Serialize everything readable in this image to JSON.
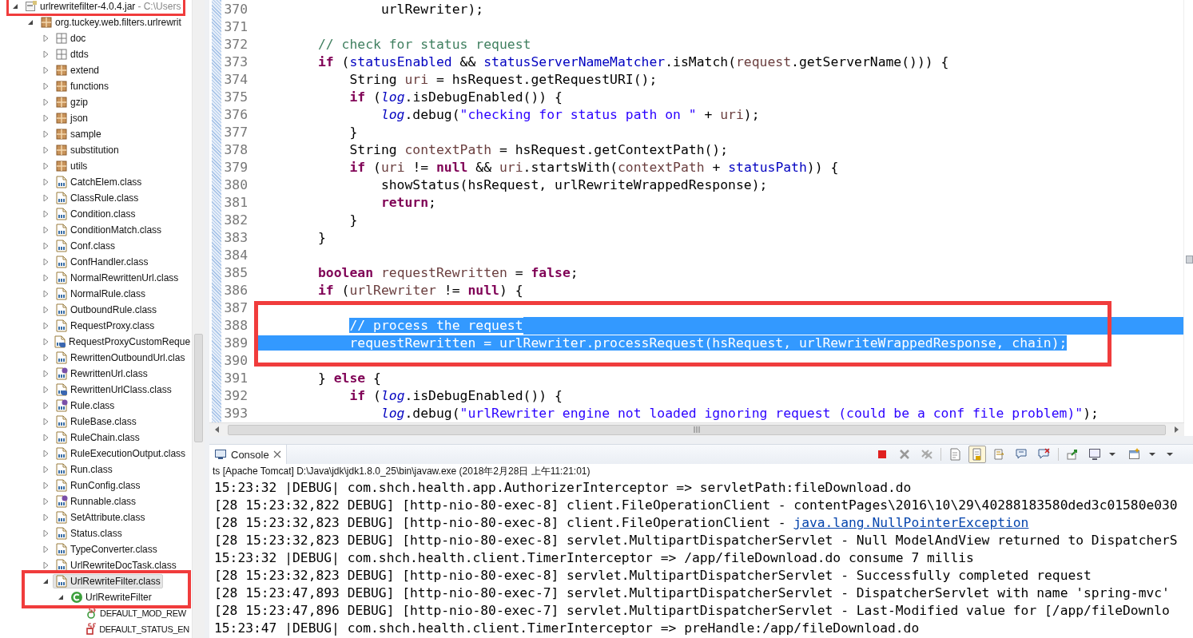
{
  "package_explorer": {
    "tree": [
      {
        "label": "urlrewritefilter-4.0.4.jar",
        "decoration": "- C:\\Users",
        "kind": "jar",
        "expanded": true,
        "selected": false,
        "children": [
          {
            "label": "org.tuckey.web.filters.urlrewrit",
            "kind": "package",
            "expanded": true,
            "selected": false,
            "children": [
              {
                "label": "doc",
                "kind": "folder",
                "expanded": false,
                "selected": false
              },
              {
                "label": "dtds",
                "kind": "folder",
                "expanded": false,
                "selected": false
              },
              {
                "label": "extend",
                "kind": "package",
                "expanded": false,
                "selected": false
              },
              {
                "label": "functions",
                "kind": "package",
                "expanded": false,
                "selected": false
              },
              {
                "label": "gzip",
                "kind": "package",
                "expanded": false,
                "selected": false
              },
              {
                "label": "json",
                "kind": "package",
                "expanded": false,
                "selected": false
              },
              {
                "label": "sample",
                "kind": "package",
                "expanded": false,
                "selected": false
              },
              {
                "label": "substitution",
                "kind": "package",
                "expanded": false,
                "selected": false
              },
              {
                "label": "utils",
                "kind": "package",
                "expanded": false,
                "selected": false
              },
              {
                "label": "CatchElem.class",
                "kind": "classfile",
                "expanded": false,
                "selected": false
              },
              {
                "label": "ClassRule.class",
                "kind": "classfile",
                "expanded": false,
                "selected": false
              },
              {
                "label": "Condition.class",
                "kind": "classfile",
                "expanded": false,
                "selected": false
              },
              {
                "label": "ConditionMatch.class",
                "kind": "classfile",
                "expanded": false,
                "selected": false
              },
              {
                "label": "Conf.class",
                "kind": "classfile",
                "expanded": false,
                "selected": false
              },
              {
                "label": "ConfHandler.class",
                "kind": "classfile",
                "expanded": false,
                "selected": false
              },
              {
                "label": "NormalRewrittenUrl.class",
                "kind": "classfile",
                "expanded": false,
                "selected": false
              },
              {
                "label": "NormalRule.class",
                "kind": "classfile",
                "expanded": false,
                "selected": false
              },
              {
                "label": "OutboundRule.class",
                "kind": "classfile",
                "expanded": false,
                "selected": false
              },
              {
                "label": "RequestProxy.class",
                "kind": "classfile",
                "expanded": false,
                "selected": false
              },
              {
                "label": "RequestProxyCustomReque",
                "kind": "classfile-inner",
                "expanded": false,
                "selected": false
              },
              {
                "label": "RewrittenOutboundUrl.clas",
                "kind": "classfile",
                "expanded": false,
                "selected": false
              },
              {
                "label": "RewrittenUrl.class",
                "kind": "classfile-interface",
                "expanded": false,
                "selected": false
              },
              {
                "label": "RewrittenUrlClass.class",
                "kind": "classfile-inner",
                "expanded": false,
                "selected": false
              },
              {
                "label": "Rule.class",
                "kind": "classfile-interface",
                "expanded": false,
                "selected": false
              },
              {
                "label": "RuleBase.class",
                "kind": "classfile",
                "expanded": false,
                "selected": false
              },
              {
                "label": "RuleChain.class",
                "kind": "classfile",
                "expanded": false,
                "selected": false
              },
              {
                "label": "RuleExecutionOutput.class",
                "kind": "classfile",
                "expanded": false,
                "selected": false
              },
              {
                "label": "Run.class",
                "kind": "classfile",
                "expanded": false,
                "selected": false
              },
              {
                "label": "RunConfig.class",
                "kind": "classfile",
                "expanded": false,
                "selected": false
              },
              {
                "label": "Runnable.class",
                "kind": "classfile-interface",
                "expanded": false,
                "selected": false
              },
              {
                "label": "SetAttribute.class",
                "kind": "classfile",
                "expanded": false,
                "selected": false
              },
              {
                "label": "Status.class",
                "kind": "classfile",
                "expanded": false,
                "selected": false
              },
              {
                "label": "TypeConverter.class",
                "kind": "classfile",
                "expanded": false,
                "selected": false
              },
              {
                "label": "UrlRewriteDocTask.class",
                "kind": "classfile",
                "expanded": false,
                "selected": false
              },
              {
                "label": "UrlRewriteFilter.class",
                "kind": "classfile",
                "expanded": true,
                "selected": true,
                "children": [
                  {
                    "label": "UrlRewriteFilter",
                    "kind": "class",
                    "expanded": true,
                    "selected": false,
                    "children": [
                      {
                        "label": "DEFAULT_MOD_REW",
                        "kind": "field-public",
                        "selected": false
                      },
                      {
                        "label": "DEFAULT_STATUS_EN",
                        "kind": "field-private",
                        "selected": false
                      }
                    ]
                  }
                ]
              }
            ]
          }
        ]
      }
    ]
  },
  "editor": {
    "lines": [
      {
        "number": "370",
        "segments": [
          {
            "text": "                urlRewriter);",
            "kind": "plain"
          }
        ]
      },
      {
        "number": "371"
      },
      {
        "number": "372",
        "segments": [
          {
            "text": "        // check for status request",
            "kind": "comment"
          }
        ]
      },
      {
        "number": "373",
        "segments": [
          {
            "text": "        if",
            "kind": "keyword"
          },
          {
            "text": " (",
            "kind": "plain"
          },
          {
            "text": "statusEnabled",
            "kind": "field"
          },
          {
            "text": " && ",
            "kind": "plain"
          },
          {
            "text": "statusServerNameMatcher",
            "kind": "field"
          },
          {
            "text": ".isMatch(",
            "kind": "plain"
          },
          {
            "text": "request",
            "kind": "variable"
          },
          {
            "text": ".getServerName())) {",
            "kind": "plain"
          }
        ]
      },
      {
        "number": "374",
        "segments": [
          {
            "text": "            String ",
            "kind": "plain"
          },
          {
            "text": "uri",
            "kind": "variable"
          },
          {
            "text": " = hsRequest.getRequestURI();",
            "kind": "plain"
          }
        ]
      },
      {
        "number": "375",
        "segments": [
          {
            "text": "            if",
            "kind": "keyword"
          },
          {
            "text": " (",
            "kind": "plain"
          },
          {
            "text": "log",
            "kind": "static"
          },
          {
            "text": ".isDebugEnabled()) {",
            "kind": "plain"
          }
        ]
      },
      {
        "number": "376",
        "segments": [
          {
            "text": "                log",
            "kind": "static"
          },
          {
            "text": ".debug(",
            "kind": "plain"
          },
          {
            "text": "\"checking for status path on \"",
            "kind": "string"
          },
          {
            "text": " + ",
            "kind": "plain"
          },
          {
            "text": "uri",
            "kind": "variable"
          },
          {
            "text": ");",
            "kind": "plain"
          }
        ]
      },
      {
        "number": "377",
        "segments": [
          {
            "text": "            }",
            "kind": "plain"
          }
        ]
      },
      {
        "number": "378",
        "segments": [
          {
            "text": "            String ",
            "kind": "plain"
          },
          {
            "text": "contextPath",
            "kind": "variable"
          },
          {
            "text": " = hsRequest.getContextPath();",
            "kind": "plain"
          }
        ]
      },
      {
        "number": "379",
        "segments": [
          {
            "text": "            if",
            "kind": "keyword"
          },
          {
            "text": " (",
            "kind": "plain"
          },
          {
            "text": "uri",
            "kind": "variable"
          },
          {
            "text": " != ",
            "kind": "plain"
          },
          {
            "text": "null",
            "kind": "keyword"
          },
          {
            "text": " && ",
            "kind": "plain"
          },
          {
            "text": "uri",
            "kind": "variable"
          },
          {
            "text": ".startsWith(",
            "kind": "plain"
          },
          {
            "text": "contextPath",
            "kind": "variable"
          },
          {
            "text": " + ",
            "kind": "plain"
          },
          {
            "text": "statusPath",
            "kind": "field"
          },
          {
            "text": ")) {",
            "kind": "plain"
          }
        ]
      },
      {
        "number": "380",
        "segments": [
          {
            "text": "                showStatus(hsRequest, urlRewriteWrappedResponse);",
            "kind": "plain"
          }
        ]
      },
      {
        "number": "381",
        "segments": [
          {
            "text": "                return",
            "kind": "keyword"
          },
          {
            "text": ";",
            "kind": "plain"
          }
        ]
      },
      {
        "number": "382",
        "segments": [
          {
            "text": "            }",
            "kind": "plain"
          }
        ]
      },
      {
        "number": "383",
        "segments": [
          {
            "text": "        }",
            "kind": "plain"
          }
        ]
      },
      {
        "number": "384"
      },
      {
        "number": "385",
        "segments": [
          {
            "text": "        boolean",
            "kind": "keyword"
          },
          {
            "text": " requestRewritten",
            "kind": "variable"
          },
          {
            "text": " = ",
            "kind": "plain"
          },
          {
            "text": "false",
            "kind": "keyword"
          },
          {
            "text": ";",
            "kind": "plain"
          }
        ]
      },
      {
        "number": "386",
        "segments": [
          {
            "text": "        if",
            "kind": "keyword"
          },
          {
            "text": " (",
            "kind": "plain"
          },
          {
            "text": "urlRewriter",
            "kind": "variable"
          },
          {
            "text": " != ",
            "kind": "plain"
          },
          {
            "text": "null",
            "kind": "keyword"
          },
          {
            "text": ") {",
            "kind": "plain"
          }
        ]
      },
      {
        "number": "387"
      },
      {
        "number": "388",
        "indent_selected": false,
        "eol_selected": true,
        "segments": [
          {
            "text": "            // process the request",
            "kind": "comment",
            "selected": true
          }
        ]
      },
      {
        "number": "389",
        "indent_selected": true,
        "eol_selected": false,
        "segments": [
          {
            "text": "            requestRewritten = urlRewriter.processRequest(hsRequest, urlRewriteWrappedResponse, chain);",
            "kind": "plain",
            "selected": true
          }
        ]
      },
      {
        "number": "390"
      },
      {
        "number": "391",
        "segments": [
          {
            "text": "        } ",
            "kind": "plain"
          },
          {
            "text": "else",
            "kind": "keyword"
          },
          {
            "text": " {",
            "kind": "plain"
          }
        ]
      },
      {
        "number": "392",
        "segments": [
          {
            "text": "            if",
            "kind": "keyword"
          },
          {
            "text": " (",
            "kind": "plain"
          },
          {
            "text": "log",
            "kind": "static"
          },
          {
            "text": ".isDebugEnabled()) {",
            "kind": "plain"
          }
        ]
      },
      {
        "number": "393",
        "segments": [
          {
            "text": "                log",
            "kind": "static"
          },
          {
            "text": ".debug(",
            "kind": "plain"
          },
          {
            "text": "\"urlRewriter engine not loaded ignoring request (could be a conf file problem)\"",
            "kind": "string"
          },
          {
            "text": ");",
            "kind": "plain"
          }
        ]
      }
    ]
  },
  "console": {
    "tab": {
      "label": "Console",
      "selected": true
    },
    "toolbar": [
      {
        "buttons": [
          {
            "kind": "terminate",
            "pressed": false
          },
          {
            "kind": "remove-launch",
            "pressed": false
          },
          {
            "kind": "remove-all",
            "pressed": false
          }
        ]
      },
      {
        "buttons": [
          {
            "kind": "clear",
            "pressed": false
          },
          {
            "kind": "scroll-lock",
            "pressed": true
          },
          {
            "kind": "word-wrap",
            "pressed": false
          },
          {
            "kind": "show-stdout",
            "pressed": false
          },
          {
            "kind": "show-stderr",
            "pressed": false
          }
        ]
      },
      {
        "buttons": [
          {
            "kind": "pin",
            "pressed": false
          },
          {
            "kind": "display-console",
            "pressed": false
          },
          {
            "kind": "dropdown",
            "pressed": false
          },
          {
            "kind": "open-console",
            "pressed": false
          },
          {
            "kind": "dropdown",
            "pressed": false
          }
        ]
      }
    ],
    "launch": "ts [Apache Tomcat] D:\\Java\\jdk\\jdk1.8.0_25\\bin\\javaw.exe (2018年2月28日 上午11:21:01)",
    "lines": [
      {
        "segments": [
          {
            "text": "15:23:32 |DEBUG| com.shch.health.app.AuthorizerInterceptor => servletPath:fileDownload.do",
            "kind": "plain"
          }
        ]
      },
      {
        "segments": [
          {
            "text": "[28 15:23:32,822 DEBUG] [http-nio-80-exec-8] client.FileOperationClient - contentPages\\2016\\10\\29\\40288183580ded3c01580e030",
            "kind": "plain"
          }
        ]
      },
      {
        "segments": [
          {
            "text": "[28 15:23:32,823 DEBUG] [http-nio-80-exec-8] client.FileOperationClient - ",
            "kind": "plain"
          },
          {
            "text": "java.lang.NullPointerException",
            "kind": "link"
          }
        ]
      },
      {
        "segments": [
          {
            "text": "[28 15:23:32,823 DEBUG] [http-nio-80-exec-8] servlet.MultipartDispatcherServlet - Null ModelAndView returned to DispatcherS",
            "kind": "plain"
          }
        ]
      },
      {
        "segments": [
          {
            "text": "15:23:32 |DEBUG| com.shch.health.client.TimerInterceptor => /app/fileDownload.do consume 7 millis",
            "kind": "plain"
          }
        ]
      },
      {
        "segments": [
          {
            "text": "[28 15:23:32,823 DEBUG] [http-nio-80-exec-8] servlet.MultipartDispatcherServlet - Successfully completed request",
            "kind": "plain"
          }
        ]
      },
      {
        "segments": [
          {
            "text": "[28 15:23:47,893 DEBUG] [http-nio-80-exec-7] servlet.MultipartDispatcherServlet - DispatcherServlet with name 'spring-mvc'",
            "kind": "plain"
          }
        ]
      },
      {
        "segments": [
          {
            "text": "[28 15:23:47,896 DEBUG] [http-nio-80-exec-7] servlet.MultipartDispatcherServlet - Last-Modified value for [/app/fileDownlo",
            "kind": "plain"
          }
        ]
      },
      {
        "segments": [
          {
            "text": "15:23:47 |DEBUG| com.shch.health.client.TimerInterceptor => preHandle:/app/fileDownload.do",
            "kind": "plain"
          }
        ]
      }
    ]
  },
  "annotation_frames": [
    {
      "kind": "rectangle"
    },
    {
      "kind": "rectangle"
    },
    {
      "kind": "rectangle"
    }
  ]
}
